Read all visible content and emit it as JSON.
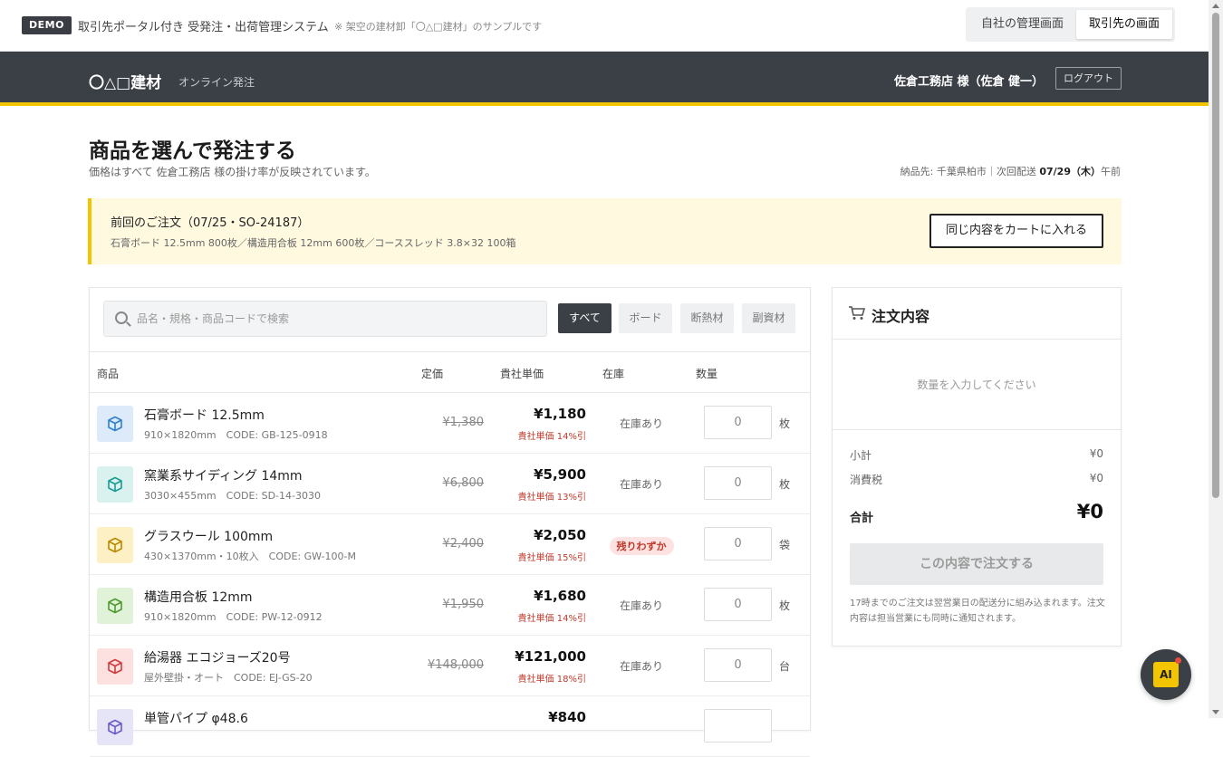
{
  "demo_bar": {
    "badge": "DEMO",
    "title": "取引先ポータル付き 受発注・出荷管理システム",
    "note": "※ 架空の建材卸「〇△□建材」のサンプルです",
    "views": [
      "自社の管理画面",
      "取引先の画面"
    ]
  },
  "header": {
    "brand": "〇△□建材",
    "subtitle": "オンライン発注",
    "user": "佐倉工務店 様（佐倉 健一）",
    "logout": "ログアウト"
  },
  "page": {
    "title": "商品を選んで発注する",
    "subtitle": "価格はすべて 佐倉工務店 様の掛け率が反映されています。",
    "delivery_prefix": "納品先: 千葉県柏市｜次回配送 ",
    "delivery_date": "07/29（木）",
    "delivery_suffix": "午前"
  },
  "previous_order": {
    "title": "前回のご注文（07/25・SO-24187）",
    "items": "石膏ボード 12.5mm 800枚／構造用合板 12mm 600枚／コーススレッド 3.8×32 100箱",
    "button": "同じ内容をカートに入れる"
  },
  "search": {
    "placeholder": "品名・規格・商品コードで検索"
  },
  "filters": [
    "すべて",
    "ボード",
    "断熱材",
    "副資材"
  ],
  "table": {
    "headers": [
      "商品",
      "定価",
      "貴社単価",
      "在庫",
      "数量"
    ],
    "rows": [
      {
        "name": "石膏ボード 12.5mm",
        "spec": "910×1820mm　CODE: GB-125-0918",
        "list": "¥1,380",
        "price": "¥1,180",
        "discount": "貴社単価 14%引",
        "stock": "在庫あり",
        "qty": "0",
        "unit": "枚",
        "icon": "box-icon",
        "tint": "#dceaf9",
        "color": "#2f7fd1"
      },
      {
        "name": "窯業系サイディング 14mm",
        "spec": "3030×455mm　CODE: SD-14-3030",
        "list": "¥6,800",
        "price": "¥5,900",
        "discount": "貴社単価 13%引",
        "stock": "在庫あり",
        "qty": "0",
        "unit": "枚",
        "icon": "box-icon",
        "tint": "#d9f1ef",
        "color": "#1a9c92"
      },
      {
        "name": "グラスウール 100mm",
        "spec": "430×1370mm・10枚入　CODE: GW-100-M",
        "list": "¥2,400",
        "price": "¥2,050",
        "discount": "貴社単価 15%引",
        "stock": "残りわずか",
        "qty": "0",
        "unit": "袋",
        "icon": "box-icon",
        "tint": "#fcf0c4",
        "color": "#b98a00"
      },
      {
        "name": "構造用合板 12mm",
        "spec": "910×1820mm　CODE: PW-12-0912",
        "list": "¥1,950",
        "price": "¥1,680",
        "discount": "貴社単価 14%引",
        "stock": "在庫あり",
        "qty": "0",
        "unit": "枚",
        "icon": "box-icon",
        "tint": "#e0f2d8",
        "color": "#4e9a2e"
      },
      {
        "name": "給湯器 エコジョーズ20号",
        "spec": "屋外壁掛・オート　CODE: EJ-GS-20",
        "list": "¥148,000",
        "price": "¥121,000",
        "discount": "貴社単価 18%引",
        "stock": "在庫あり",
        "qty": "0",
        "unit": "台",
        "icon": "box-icon",
        "tint": "#fde0e0",
        "color": "#d43a3a"
      },
      {
        "name": "単管パイプ φ48.6",
        "spec": "",
        "list": "",
        "price": "¥840",
        "discount": "",
        "stock": "",
        "qty": "",
        "unit": "",
        "icon": "box-icon",
        "tint": "#e6e4f7",
        "color": "#6a5acd"
      }
    ]
  },
  "cart": {
    "title": "注文内容",
    "empty": "数量を入力してください",
    "subtotal_label": "小計",
    "subtotal": "¥0",
    "tax_label": "消費税",
    "tax": "¥0",
    "total_label": "合計",
    "total": "¥0",
    "order_button": "この内容で注文する",
    "note": "17時までのご注文は翌営業日の配送分に組み込まれます。注文内容は担当営業にも同時に通知されます。"
  },
  "ai_button": "AI"
}
